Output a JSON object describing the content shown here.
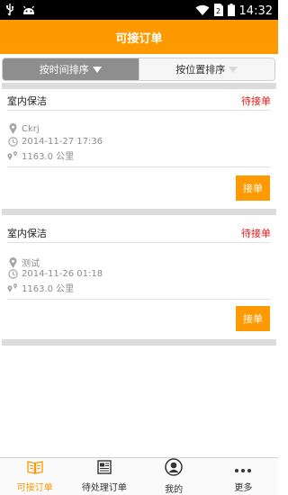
{
  "status_bar": {
    "time": "14:32",
    "icons": [
      "usb-icon",
      "android-icon",
      "wifi-icon",
      "sim-icon",
      "battery-icon"
    ]
  },
  "header": {
    "title": "可接订单"
  },
  "sort": {
    "by_time": "按时间排序",
    "by_location": "按位置排序"
  },
  "orders": [
    {
      "title": "室内保洁",
      "status": "待接单",
      "place": "Ckrj",
      "time": "2014-11-27 17:36",
      "distance": "1163.0 公里",
      "action": "接单"
    },
    {
      "title": "室内保洁",
      "status": "待接单",
      "place": "测试",
      "time": "2014-11-26 01:18",
      "distance": "1163.0 公里",
      "action": "接单"
    }
  ],
  "nav": [
    {
      "label": "可接订单",
      "icon": "book-icon",
      "active": true
    },
    {
      "label": "待处理订单",
      "icon": "newspaper-icon",
      "active": false
    },
    {
      "label": "我的",
      "icon": "user-icon",
      "active": false
    },
    {
      "label": "更多",
      "icon": "more-icon",
      "active": false
    }
  ],
  "colors": {
    "accent": "#ff9900",
    "status": "#e01b1b"
  }
}
